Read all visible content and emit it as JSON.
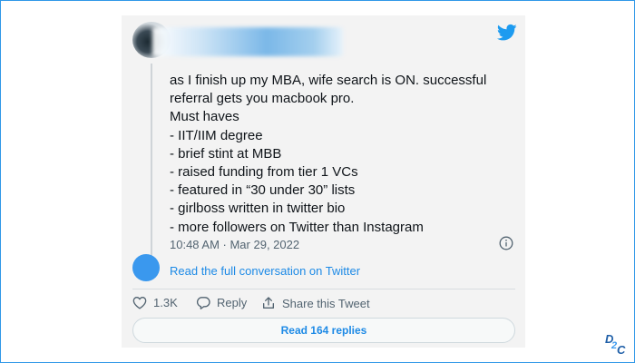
{
  "tweet": {
    "lines": [
      "as I finish up my MBA, wife search is ON. successful",
      "referral gets you macbook pro.",
      "Must haves",
      "- IIT/IIM degree",
      "- brief stint at MBB",
      "- raised funding from tier 1 VCs",
      "- featured in “30 under 30” lists",
      "- girlboss written in twitter bio",
      "- more followers on Twitter than Instagram"
    ],
    "timestamp": "10:48 AM · Mar 29, 2022"
  },
  "conversation": {
    "link_label": "Read the full conversation on Twitter"
  },
  "actions": {
    "likes_count": "1.3K",
    "reply_label": "Reply",
    "share_label": "Share this Tweet"
  },
  "read_replies_label": "Read 164 replies",
  "logo": {
    "text": "D2C"
  },
  "colors": {
    "twitter_blue": "#1d9bf0",
    "card_bg": "#f3f3f3",
    "frame": "#2f98e8"
  },
  "icons": [
    "twitter-bird-icon",
    "info-icon",
    "heart-icon",
    "reply-bubble-icon",
    "share-icon"
  ]
}
